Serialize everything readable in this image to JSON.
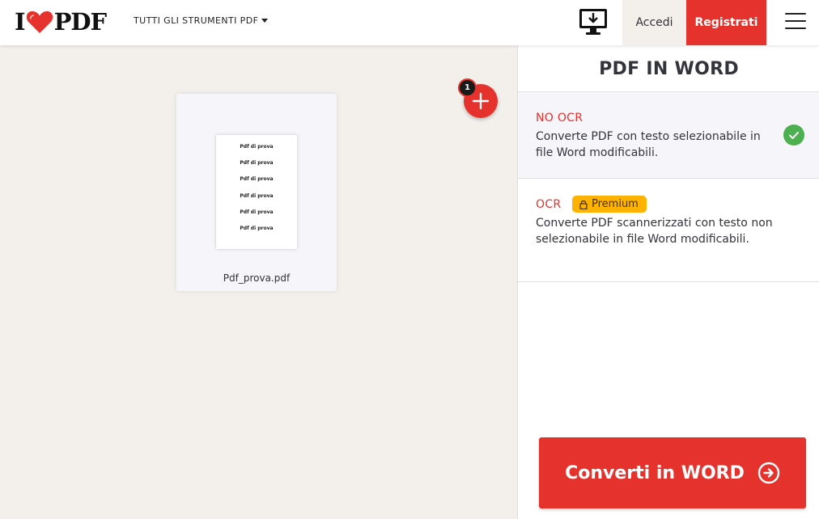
{
  "header": {
    "logo": {
      "left": "I",
      "right": "PDF"
    },
    "tools_menu_label": "TUTTI GLI STRUMENTI PDF",
    "desktop_icon": "desktop-download-icon",
    "login_label": "Accedi",
    "signup_label": "Registrati",
    "menu_icon": "hamburger-menu-icon"
  },
  "workspace": {
    "file_count": "1",
    "file": {
      "name": "Pdf_prova.pdf",
      "page_lines": [
        "Pdf di prova",
        "Pdf di prova",
        "Pdf di prova",
        "Pdf di prova",
        "Pdf di prova",
        "Pdf di prova"
      ]
    },
    "add_icon": "plus-icon"
  },
  "sidebar": {
    "title": "PDF IN WORD",
    "options": [
      {
        "title": "NO OCR",
        "description": "Converte PDF con testo selezionabile in file Word modificabili.",
        "selected": true,
        "icon": "check-circle-icon"
      },
      {
        "title": "OCR",
        "badge": "Premium",
        "badge_icon": "lock-icon",
        "description": "Converte PDF scannerizzati con testo non selezionabile in file Word modificabili.",
        "selected": false
      }
    ],
    "convert_label": "Converti in WORD",
    "convert_icon": "arrow-circle-right-icon"
  },
  "colors": {
    "brand_red": "#e5322d",
    "premium_yellow": "#ffb300",
    "check_green": "#4caf50",
    "workspace_bg": "#f3f0ec"
  }
}
